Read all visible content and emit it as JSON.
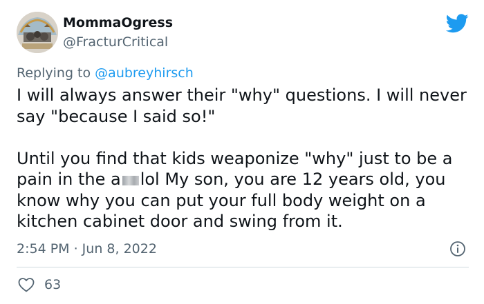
{
  "author": {
    "display_name": "MommaOgress",
    "handle": "@FracturCritical"
  },
  "reply": {
    "prefix": "Replying to",
    "mention": "@aubreyhirsch"
  },
  "tweet": {
    "paragraph1": "I will always answer their \"why\" questions. I will never say \"because I said so!\"",
    "paragraph2_before_redaction": "Until you find that kids weaponize \"why\" just to be a pain in the a",
    "paragraph2_after_redaction": "lol My son, you are 12 years old, you know why you can put your full body weight on a kitchen cabinet door and swing from it."
  },
  "meta": {
    "timestamp": "2:54 PM · Jun 8, 2022"
  },
  "engagement": {
    "likes": "63"
  },
  "icons": {
    "brand": "twitter-bird-icon",
    "info": "info-icon",
    "like": "heart-icon"
  },
  "colors": {
    "brand_blue": "#1d9bf0",
    "text": "#0f1419",
    "secondary_text": "#536471",
    "divider": "#cfd9de"
  }
}
